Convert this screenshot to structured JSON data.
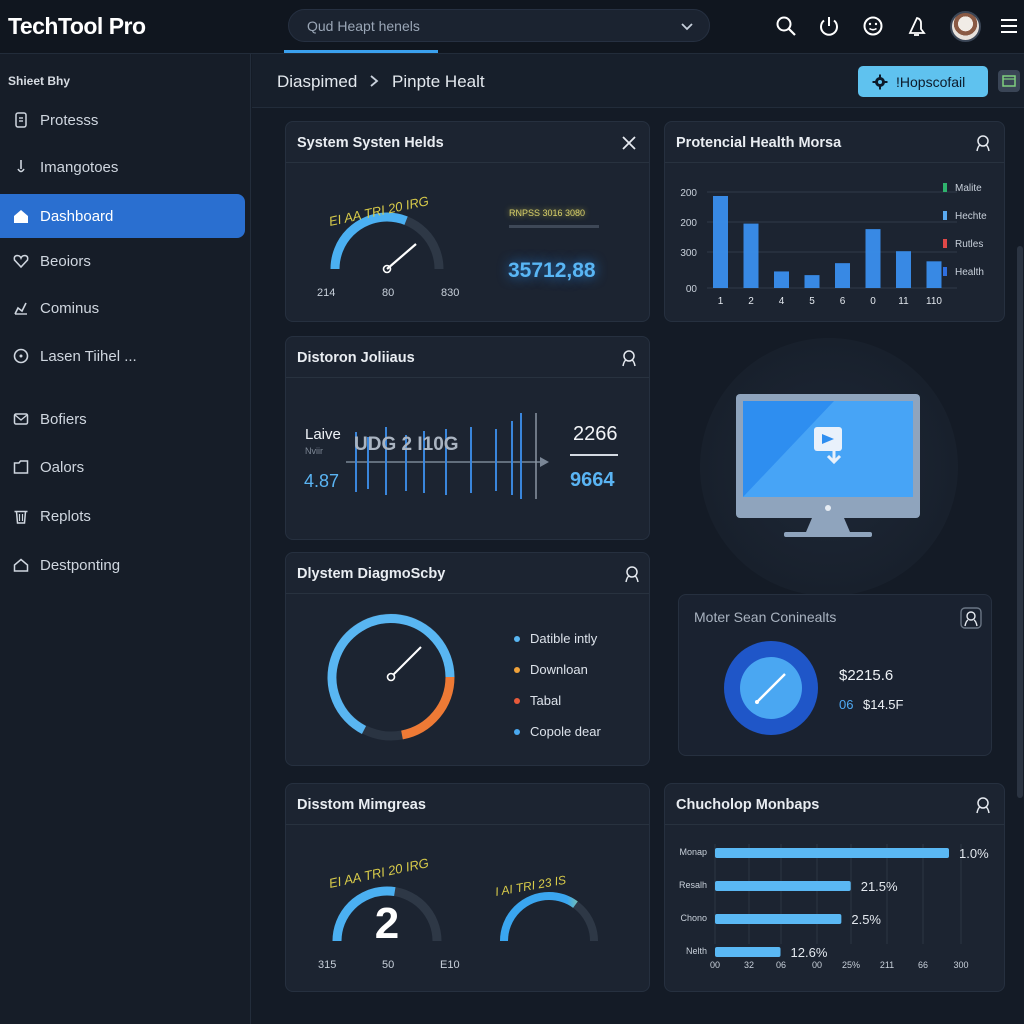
{
  "app": {
    "name": "TechTool Pro"
  },
  "search": {
    "value": "Qud   Heapt henels"
  },
  "top_icons": [
    "search-icon",
    "power-icon",
    "smiley-icon",
    "bell-icon",
    "menu-icon"
  ],
  "sidebar": {
    "heading": "Shieet Bhy",
    "items": [
      {
        "label": "Protesss",
        "icon": "document-icon"
      },
      {
        "label": "Imangotoes",
        "icon": "pin-icon"
      },
      {
        "label": "Dashboard",
        "icon": "home-icon",
        "active": true
      },
      {
        "label": "Beoiors",
        "icon": "heart-icon"
      },
      {
        "label": "Cominus",
        "icon": "gear-icon"
      },
      {
        "label": "Lasen Tiihel ...",
        "icon": "clock-icon"
      },
      {
        "label": "Bofiers",
        "icon": "mail-icon"
      },
      {
        "label": "Oalors",
        "icon": "folder-icon"
      },
      {
        "label": "Replots",
        "icon": "trash-icon"
      },
      {
        "label": "Destponting",
        "icon": "home-outline-icon"
      }
    ]
  },
  "breadcrumb": {
    "first": "Diaspimed",
    "second": "Pinpte Healt"
  },
  "header_button": {
    "label": "!Hopscofail"
  },
  "cards": {
    "system_helds": {
      "title": "System Systen Helds",
      "gauge_scale": "EI AA TRI 20 IRG",
      "gauge_min": "214",
      "gauge_mid": "80",
      "gauge_max": "830",
      "gauge_level": 0.62,
      "glow_caption": "RNPSS  3016   3080",
      "value": "35712,88"
    },
    "health_morsa": {
      "title": "Protencial Health Morsa",
      "legend": [
        {
          "label": "Malite",
          "color": "#2fb36d"
        },
        {
          "label": "Hechte",
          "color": "#5aa9f0"
        },
        {
          "label": "Rutles",
          "color": "#e04848"
        },
        {
          "label": "Health",
          "color": "#2f6fe0"
        }
      ]
    },
    "distoron": {
      "title": "Distoron Joliiaus",
      "left_label": "Laive",
      "left_small": "Nviir",
      "left_value": "4.87",
      "overlay": "UDG 2 I10G",
      "right_top": "2266",
      "right_value": "9664"
    },
    "diagnostics": {
      "title": "Dlystem DiagmoScby",
      "gauge_level": 0.7,
      "legend": [
        {
          "label": "Datible intly",
          "color": "#59b6f2"
        },
        {
          "label": "Downloan",
          "color": "#f0a23a"
        },
        {
          "label": "Tabal",
          "color": "#e85a3a"
        },
        {
          "label": "Copole dear",
          "color": "#4aa9f0"
        }
      ]
    },
    "moter_scan": {
      "title": "Moter Sean Coninealts",
      "value": "$2215.6",
      "sub_left": "06",
      "sub_right": "$14.5F"
    },
    "mimgreas": {
      "title": "Disstom Mimgreas",
      "gauge1_scale": "EI AA TRI 20 IRG",
      "gauge1_value": "2",
      "gauge1_level": 0.55,
      "gauge1_min": "315",
      "gauge1_mid": "50",
      "gauge1_max": "E10",
      "gauge2_scale": "I AI TRI 23 IS",
      "gauge2_level": 0.7
    },
    "monbaps": {
      "title": "Chucholop Monbaps"
    }
  },
  "chart_data": [
    {
      "type": "bar",
      "title": "Protencial Health Morsa",
      "categories": [
        "1",
        "2",
        "4",
        "5",
        "6",
        "0",
        "11",
        "110"
      ],
      "y_tick_labels": [
        "200",
        "200",
        "300",
        "00"
      ],
      "values": [
        100,
        70,
        18,
        14,
        27,
        64,
        40,
        29
      ],
      "ylim": [
        0,
        100
      ],
      "grid": true,
      "legend_placement": "right"
    },
    {
      "type": "bar",
      "orientation": "horizontal",
      "title": "Chucholop Monbaps",
      "categories": [
        "Monap",
        "Resalh",
        "Chono",
        "Nelth"
      ],
      "values": [
        100,
        58,
        54,
        28
      ],
      "value_labels": [
        "1.0%",
        "21.5%",
        "2.5%",
        "12.6%"
      ],
      "x_tick_labels": [
        "00",
        "32",
        "06",
        "00",
        "25%",
        "211",
        "66",
        "300"
      ],
      "xlim": [
        0,
        100
      ],
      "grid": true
    }
  ]
}
